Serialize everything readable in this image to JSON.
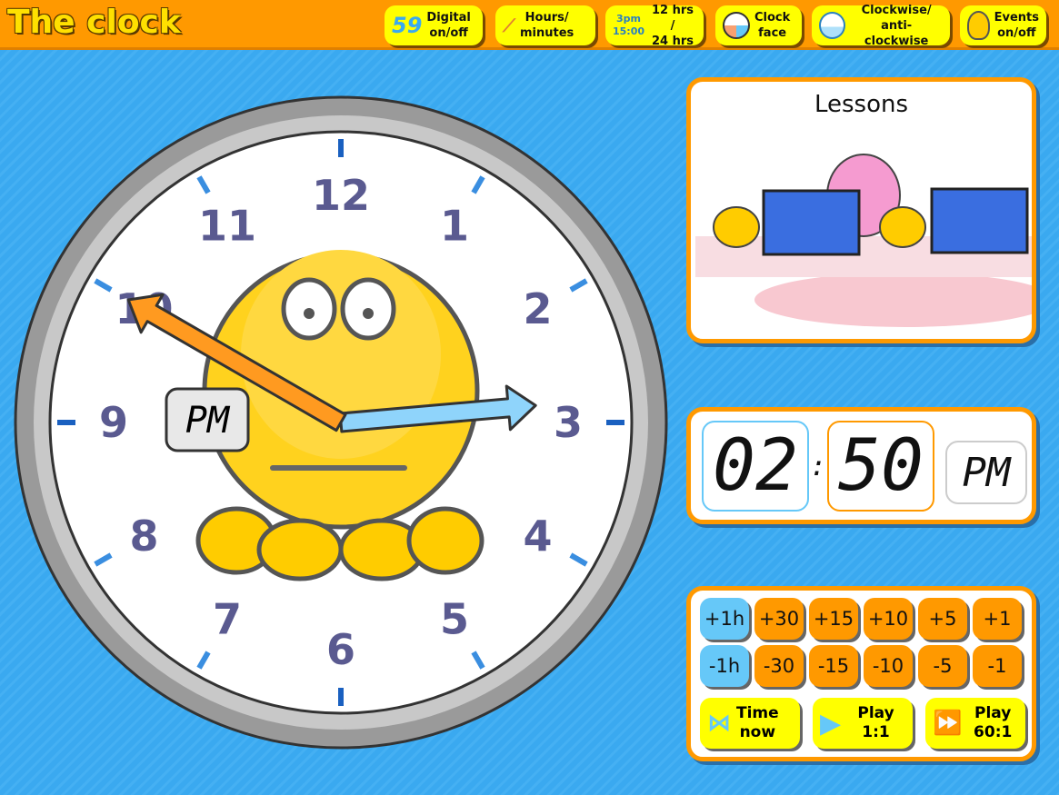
{
  "app": {
    "title": "The clock"
  },
  "toolbar": [
    {
      "icon": "59",
      "line1": "Digital",
      "line2": "on/off"
    },
    {
      "icon": "hands-icon",
      "line1": "Hours/",
      "line2": "minutes"
    },
    {
      "icon": "3pm/15:00",
      "line1": "12 hrs /",
      "line2": "24 hrs"
    },
    {
      "icon": "clock-face-icon",
      "line1": "Clock",
      "line2": "face"
    },
    {
      "icon": "gauge-icon",
      "line1": "Clockwise/",
      "line2": "anti-clockwise"
    },
    {
      "icon": "character-icon",
      "line1": "Events",
      "line2": "on/off"
    }
  ],
  "clock": {
    "numbers": [
      "12",
      "1",
      "2",
      "3",
      "4",
      "5",
      "6",
      "7",
      "8",
      "9",
      "10",
      "11"
    ],
    "hour": 2,
    "minute": 50,
    "ampm": "PM"
  },
  "lessons": {
    "title": "Lessons"
  },
  "digital": {
    "hours": "02",
    "sep": ":",
    "minutes": "50",
    "ampm": "PM"
  },
  "controls": {
    "row1": [
      "+1h",
      "+30",
      "+15",
      "+10",
      "+5",
      "+1"
    ],
    "row2": [
      "-1h",
      "-30",
      "-15",
      "-10",
      "-5",
      "-1"
    ],
    "time_now": [
      "Time",
      "now"
    ],
    "play11": [
      "Play",
      "1:1"
    ],
    "play60": [
      "Play",
      "60:1"
    ]
  },
  "colors": {
    "orange": "#ff9900",
    "yellow": "#ffff00",
    "blue": "#66c8f8",
    "background": "#3aa9f0"
  }
}
